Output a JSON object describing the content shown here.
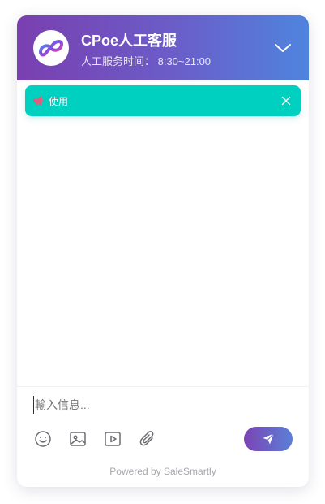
{
  "header": {
    "title": "CPoe人工客服",
    "subtitle": "人工服务时间： 8:30~21:00",
    "logo_icon": "infinity-logo-icon",
    "collapse_icon": "chevron-down-icon"
  },
  "notice": {
    "icon": "megaphone-icon",
    "text": "使用",
    "close_icon": "close-icon",
    "color": "#00d0c0"
  },
  "composer": {
    "placeholder": "輸入信息...",
    "value": "",
    "tools": [
      "emoji-icon",
      "image-icon",
      "video-icon",
      "attachment-icon"
    ],
    "send_icon": "send-icon"
  },
  "footer": {
    "powered_by": "Powered by SaleSmartly"
  },
  "colors": {
    "header_start": "#7a3fb0",
    "header_end": "#4f84de",
    "accent": "#00d0c0"
  }
}
